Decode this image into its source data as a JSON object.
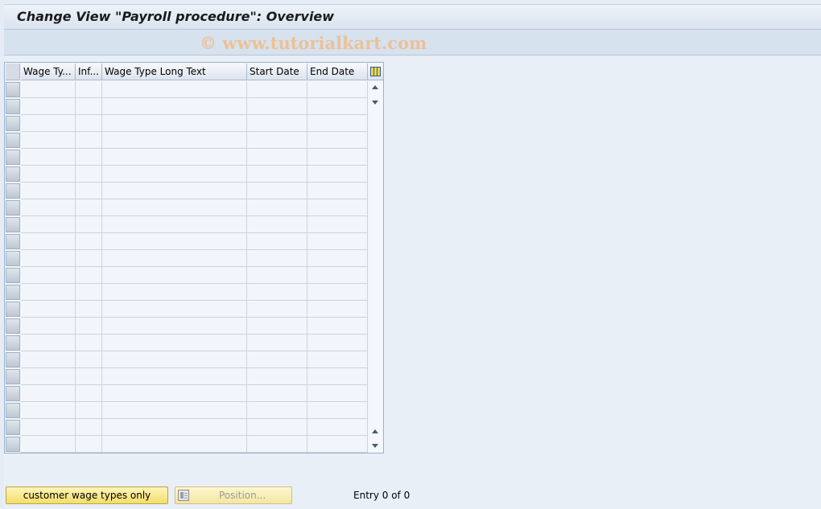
{
  "window": {
    "title": "Change View \"Payroll procedure\": Overview"
  },
  "watermark": "© www.tutorialkart.com",
  "table": {
    "columns": [
      "Wage Ty...",
      "Inf...",
      "Wage Type Long Text",
      "Start Date",
      "End Date"
    ],
    "config_icon": "table-settings-icon"
  },
  "footer": {
    "customer_button": "customer wage types only",
    "position_button": "Position...",
    "entry_text": "Entry 0 of 0"
  },
  "colors": {
    "button_yellow": "#f4de6a",
    "background": "#e5ecf5",
    "header": "#d6e2ee"
  }
}
